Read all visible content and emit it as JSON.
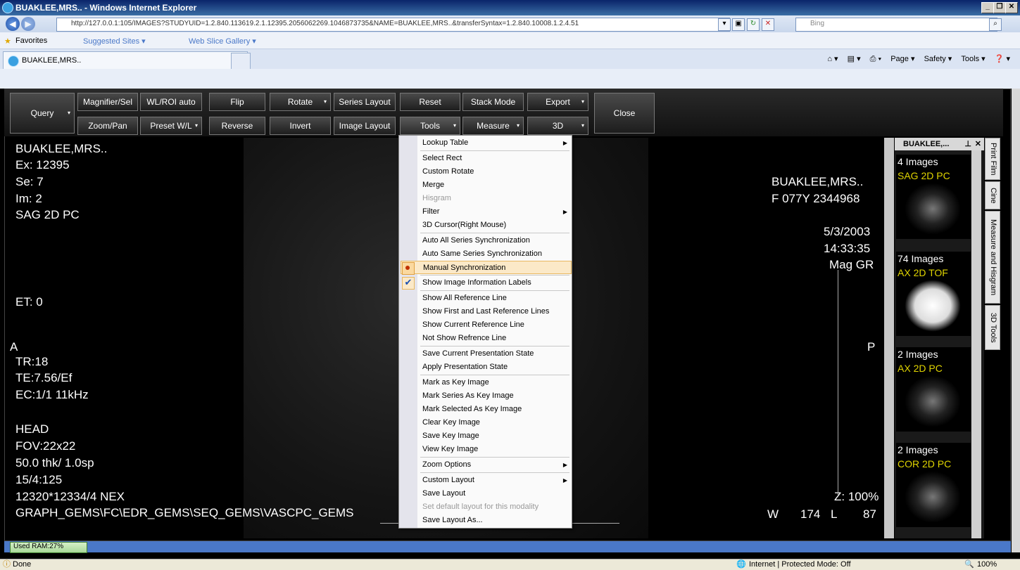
{
  "window": {
    "title": "BUAKLEE,MRS.. - Windows Internet Explorer",
    "minimize": "_",
    "maximize": "❐",
    "close": "✕"
  },
  "address": {
    "url": "http://127.0.0.1:105/IMAGES?STUDYUID=1.2.840.113619.2.1.12395.2056062269.1046873735&NAME=BUAKLEE,MRS..&transferSyntax=1.2.840.10008.1.2.4.51",
    "search_placeholder": "Bing"
  },
  "favorites": {
    "label": "Favorites",
    "items": [
      "Suggested Sites ▾",
      "Web Slice Gallery ▾"
    ]
  },
  "tabs": {
    "active": "BUAKLEE,MRS..",
    "commands": [
      "Page ▾",
      "Safety ▾",
      "Tools ▾"
    ]
  },
  "toolbar": {
    "query": "Query",
    "row1": [
      "Magnifier/Sel",
      "WL/ROI auto",
      "Flip",
      "Rotate",
      "Series Layout",
      "Reset",
      "Stack Mode",
      "Export"
    ],
    "row2": [
      "Zoom/Pan",
      "Preset W/L",
      "Reverse",
      "Invert",
      "Image Layout",
      "Tools",
      "Measure",
      "3D"
    ],
    "close": "Close"
  },
  "overlay": {
    "left": [
      "BUAKLEE,MRS..",
      "Ex: 12395",
      "Se: 7",
      "Im: 2",
      "SAG 2D PC"
    ],
    "et": "ET: 0",
    "orient_left": "A",
    "params": [
      "TR:18",
      "TE:7.56/Ef",
      "EC:1/1 11kHz"
    ],
    "params2": [
      "HEAD",
      "FOV:22x22",
      "50.0 thk/ 1.0sp",
      "15/4:125",
      "12320*12334/4 NEX",
      "GRAPH_GEMS\\FC\\EDR_GEMS\\SEQ_GEMS\\VASCPC_GEMS"
    ],
    "right": [
      "BUAKLEE,MRS..",
      "F 077Y 2344968"
    ],
    "right2": [
      "5/3/2003",
      "14:33:35",
      "Mag GR"
    ],
    "orient_right": "P",
    "zoom": "Z: 100%",
    "w_label": "W",
    "w_value": "174",
    "l_label": "L",
    "l_value": "87"
  },
  "series_panel": {
    "title": "BUAKLEE,...",
    "thumbs": [
      {
        "count": "4 Images",
        "name": "SAG 2D PC"
      },
      {
        "count": "74 Images",
        "name": "AX 2D TOF"
      },
      {
        "count": "2 Images",
        "name": "AX 2D PC"
      },
      {
        "count": "2 Images",
        "name": "COR 2D PC"
      }
    ]
  },
  "side_tabs": [
    "Print Film",
    "Cine",
    "Measure and Hisgram",
    "3D Tools"
  ],
  "menu": {
    "items": [
      {
        "label": "Lookup Table",
        "sub": true
      },
      {
        "label": "Select Rect"
      },
      {
        "label": "Custom Rotate"
      },
      {
        "label": "Merge"
      },
      {
        "label": "Hisgram",
        "disabled": true
      },
      {
        "label": "Filter",
        "sub": true
      },
      {
        "label": "3D Cursor(Right Mouse)"
      },
      {
        "label": "Auto All Series Synchronization"
      },
      {
        "label": "Auto Same Series Synchronization"
      },
      {
        "label": "Manual Synchronization",
        "radio": true,
        "highlight": true
      },
      {
        "label": "Show Image Information Labels",
        "check": true
      },
      {
        "label": "Show All Reference Line"
      },
      {
        "label": "Show First and Last Reference Lines"
      },
      {
        "label": "Show Current Reference Line"
      },
      {
        "label": "Not Show Refrence Line"
      },
      {
        "label": "Save Current Presentation State"
      },
      {
        "label": "Apply Presentation State"
      },
      {
        "label": "Mark as Key Image"
      },
      {
        "label": "Mark Series As Key  Image"
      },
      {
        "label": "Mark Selected As Key Image"
      },
      {
        "label": "Clear Key Image"
      },
      {
        "label": "Save Key Image"
      },
      {
        "label": "View Key Image"
      },
      {
        "label": "Zoom Options",
        "sub": true
      },
      {
        "label": "Custom Layout",
        "sub": true
      },
      {
        "label": "Save Layout"
      },
      {
        "label": "Set default layout for this modality",
        "disabled": true
      },
      {
        "label": "Save Layout As..."
      }
    ]
  },
  "status": {
    "ram": "Used RAM:27%",
    "done": "Done",
    "zone": "Internet | Protected Mode: Off",
    "zoom": "100%"
  }
}
